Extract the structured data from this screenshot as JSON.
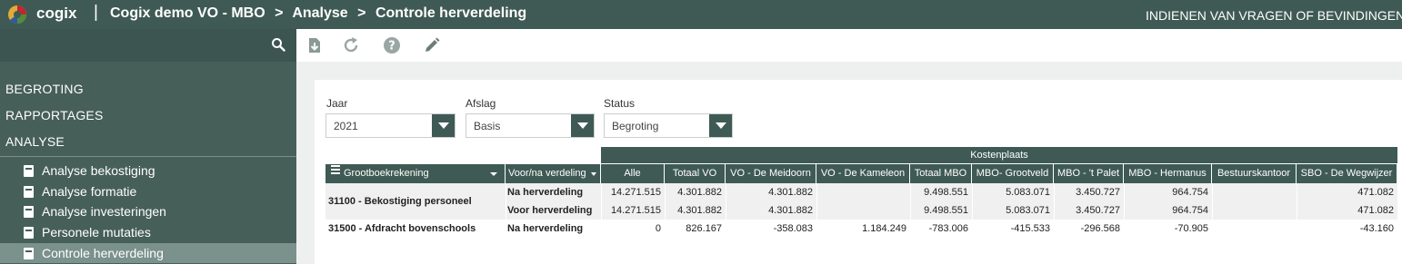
{
  "header": {
    "brand": "cogix",
    "separator": "|",
    "breadcrumb": [
      "Cogix demo VO - MBO",
      ">",
      "Analyse",
      ">",
      "Controle herverdeling"
    ],
    "right_link": "INDIENEN VAN VRAGEN OF BEVINDINGEN",
    "logo_colors": [
      "#e2a93b",
      "#c2262e",
      "#4f8d3a",
      "#2c5c9e"
    ]
  },
  "sidebar": {
    "search_icon": "search-icon",
    "sections": [
      "BEGROTING",
      "RAPPORTAGES",
      "ANALYSE"
    ],
    "items": [
      {
        "label": "Analyse bekostiging",
        "active": false
      },
      {
        "label": "Analyse formatie",
        "active": false
      },
      {
        "label": "Analyse investeringen",
        "active": false
      },
      {
        "label": "Personele mutaties",
        "active": false
      },
      {
        "label": "Controle herverdeling",
        "active": true
      }
    ]
  },
  "toolbar": {
    "icons": [
      "download-icon",
      "refresh-icon",
      "help-icon",
      "edit-icon"
    ]
  },
  "filters": {
    "jaar": {
      "label": "Jaar",
      "value": "2021"
    },
    "afslag": {
      "label": "Afslag",
      "value": "Basis"
    },
    "status": {
      "label": "Status",
      "value": "Begroting"
    }
  },
  "table": {
    "group_header": "Kostenplaats",
    "col_grootboek": "Grootboekrekening",
    "col_voorna": "Voor/na verdeling",
    "columns": [
      "Alle",
      "Totaal VO",
      "VO - De Meidoorn",
      "VO - De Kameleon",
      "Totaal MBO",
      "MBO- Grootveld",
      "MBO - 't Palet",
      "MBO - Hermanus",
      "Bestuurskantoor",
      "SBO - De Wegwijzer"
    ],
    "rows": [
      {
        "group": "31100 - Bekostiging personeel",
        "sub": "Na herverdeling",
        "values": [
          "14.271.515",
          "4.301.882",
          "4.301.882",
          "",
          "9.498.551",
          "5.083.071",
          "3.450.727",
          "964.754",
          "",
          "471.082"
        ]
      },
      {
        "group": "",
        "sub": "Voor herverdeling",
        "values": [
          "14.271.515",
          "4.301.882",
          "4.301.882",
          "",
          "9.498.551",
          "5.083.071",
          "3.450.727",
          "964.754",
          "",
          "471.082"
        ]
      },
      {
        "group": "31500 - Afdracht bovenschools",
        "sub": "Na herverdeling",
        "values": [
          "0",
          "826.167",
          "-358.083",
          "1.184.249",
          "-783.006",
          "-415.533",
          "-296.568",
          "-70.905",
          "",
          "-43.160"
        ]
      }
    ]
  }
}
